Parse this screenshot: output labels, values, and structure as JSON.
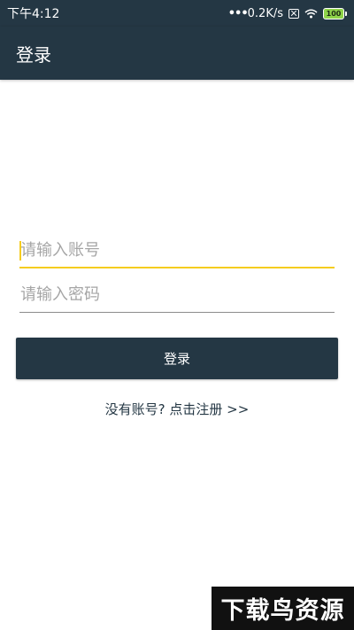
{
  "status_bar": {
    "time": "下午4:12",
    "dots": "•••",
    "network_speed": "0.2K/s",
    "battery": "100",
    "sim_icon": "sim-off-icon",
    "wifi_icon": "wifi-icon",
    "battery_icon": "battery-icon"
  },
  "app_bar": {
    "title": "登录"
  },
  "form": {
    "username_placeholder": "请输入账号",
    "username_value": "",
    "password_placeholder": "请输入密码",
    "password_value": "",
    "login_label": "登录"
  },
  "register_link": "没有账号? 点击注册 >>",
  "watermark": "下载鸟资源",
  "colors": {
    "primary": "#243744",
    "accent": "#f5cc1f",
    "battery": "#8fd34a"
  }
}
